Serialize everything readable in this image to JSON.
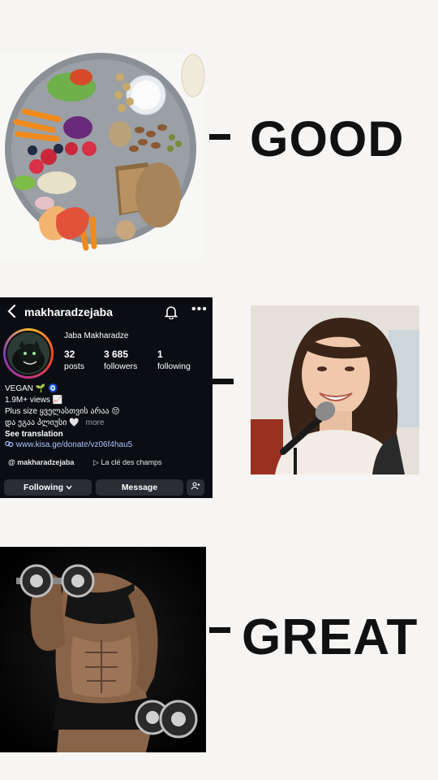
{
  "rows": {
    "first_word": "GOOD",
    "last_word": "GREAT"
  },
  "instagram": {
    "username": "makharadzejaba",
    "full_name": "Jaba Makharadze",
    "stats": {
      "posts_count": "32",
      "posts_label": "posts",
      "followers_count": "3 685",
      "followers_label": "followers",
      "following_count": "1",
      "following_label": "following"
    },
    "bio": {
      "line1": "VEGAN 🌱 🧿",
      "line2": "1.9M+ views 📈",
      "line3": "Plus size ყველასთვის არაა 😔",
      "line4": "და ეგაა პლიუსი 🤍",
      "more": "more",
      "see_translation": "See translation",
      "link": "www.kisa.ge/donate/vz06f4hau5"
    },
    "threads_chip": "makharadzejaba",
    "music_chip": "La clé des champs",
    "buttons": {
      "following": "Following",
      "message": "Message"
    },
    "icons": {
      "back": "chevron-left-icon",
      "bell": "bell-icon",
      "more": "more-horizontal-icon",
      "link": "link-icon",
      "threads": "threads-icon",
      "music": "play-icon",
      "add_user": "add-user-icon",
      "dropdown": "chevron-down-icon"
    }
  },
  "colors": {
    "background": "#f6f5f3",
    "card": "#0b0d12",
    "button": "#2a2d33",
    "link": "#a9c4ff"
  }
}
